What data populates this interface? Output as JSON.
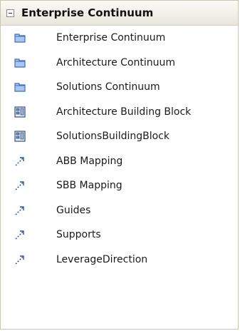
{
  "panel": {
    "title": "Enterprise Continuum",
    "items": [
      {
        "label": "Enterprise Continuum",
        "icon": "folder-tab-icon"
      },
      {
        "label": "Architecture Continuum",
        "icon": "folder-tab-icon"
      },
      {
        "label": "Solutions Continuum",
        "icon": "folder-tab-icon"
      },
      {
        "label": "Architecture Building Block",
        "icon": "building-block-icon"
      },
      {
        "label": "SolutionsBuildingBlock",
        "icon": "building-block-icon"
      },
      {
        "label": "ABB Mapping",
        "icon": "dashed-arrow-icon"
      },
      {
        "label": "SBB Mapping",
        "icon": "dashed-arrow-icon"
      },
      {
        "label": "Guides",
        "icon": "dashed-arrow-icon"
      },
      {
        "label": "Supports",
        "icon": "dashed-arrow-icon"
      },
      {
        "label": "LeverageDirection",
        "icon": "dashed-arrow-icon"
      }
    ]
  },
  "colors": {
    "folder_fill": "#aac6f0",
    "folder_stroke": "#3d6fbf",
    "block_stroke": "#37507a",
    "arrow_stroke": "#2a4fa3"
  }
}
